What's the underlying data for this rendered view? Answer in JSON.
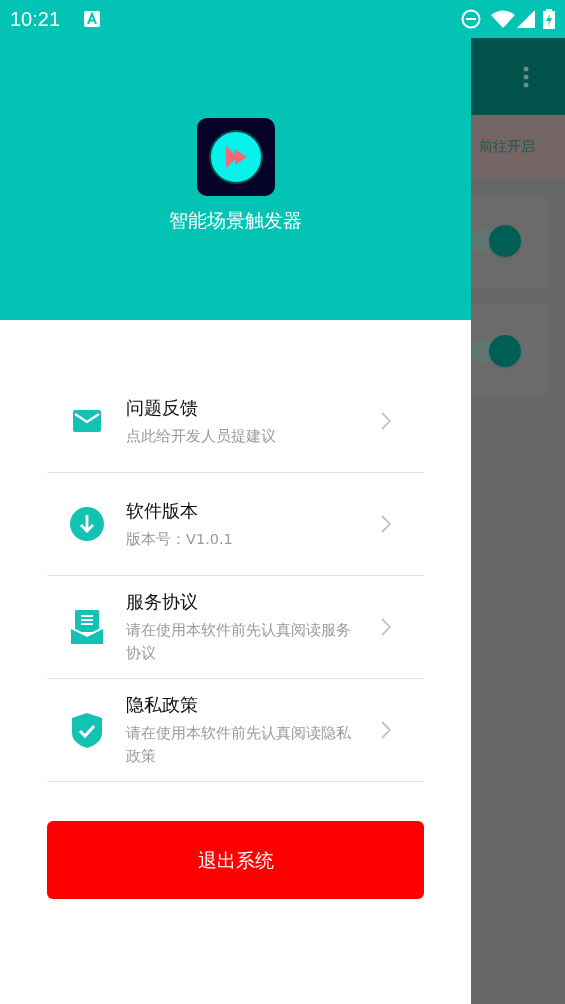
{
  "status_bar": {
    "time": "10:21"
  },
  "drawer": {
    "app_name": "智能场景触发器",
    "items": [
      {
        "kind": "mail",
        "title": "问题反馈",
        "subtitle": "点此给开发人员提建议"
      },
      {
        "kind": "download",
        "title": "软件版本",
        "subtitle": "版本号：V1.0.1"
      },
      {
        "kind": "document",
        "title": "服务协议",
        "subtitle": "请在使用本软件前先认真阅读服务协议"
      },
      {
        "kind": "shield",
        "title": "隐私政策",
        "subtitle": "请在使用本软件前先认真阅读隐私政策"
      }
    ],
    "logout_button": "退出系统"
  },
  "background_screen": {
    "banner_action": "前往开启",
    "switches": [
      {
        "on": true
      },
      {
        "on": true
      }
    ]
  }
}
